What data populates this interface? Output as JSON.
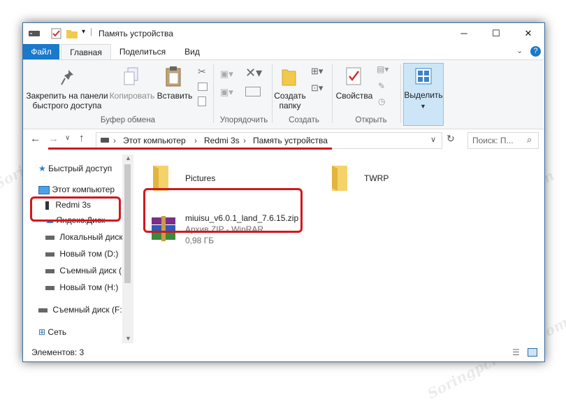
{
  "window": {
    "title": "Память устройства",
    "controls": {
      "minimize": "─",
      "maximize": "☐",
      "close": "✕"
    }
  },
  "ribbon": {
    "tabs": [
      {
        "label": "Файл"
      },
      {
        "label": "Главная"
      },
      {
        "label": "Поделиться"
      },
      {
        "label": "Вид"
      }
    ],
    "pin_label_1": "Закрепить на панели",
    "pin_label_2": "быстрого доступа",
    "copy_label": "Копировать",
    "paste_label": "Вставить",
    "new_folder_1": "Создать",
    "new_folder_2": "папку",
    "properties_label": "Свойства",
    "select_label": "Выделить",
    "groups": {
      "clipboard": "Буфер обмена",
      "organize": "Упорядочить",
      "create": "Создать",
      "open": "Открыть"
    }
  },
  "address": {
    "crumbs": [
      "Этот компьютер",
      "Redmi 3s",
      "Память устройства"
    ],
    "search_placeholder": "Поиск: П...",
    "separator": "›"
  },
  "nav": {
    "items": [
      {
        "label": "Быстрый доступ",
        "icon": "star-icon"
      },
      {
        "label": "Этот компьютер",
        "icon": "computer-icon"
      },
      {
        "label": "Redmi 3s",
        "icon": "phone-icon"
      },
      {
        "label": "Яндекс.Диск",
        "icon": "cloud-icon"
      },
      {
        "label": "Локальный диск",
        "icon": "drive-icon"
      },
      {
        "label": "Новый том (D:)",
        "icon": "drive-icon"
      },
      {
        "label": "Съемный диск (",
        "icon": "drive-icon"
      },
      {
        "label": "Новый том (H:)",
        "icon": "drive-icon"
      },
      {
        "label": "Съемный диск (F:",
        "icon": "drive-icon"
      },
      {
        "label": "Сеть",
        "icon": "network-icon"
      }
    ]
  },
  "files": [
    {
      "name": "Pictures",
      "type": "folder"
    },
    {
      "name": "TWRP",
      "type": "folder"
    },
    {
      "name": "miuisu_v6.0.1_land_7.6.15.zip",
      "kind": "Архив ZIP - WinRAR",
      "size": "0,98 ГБ",
      "type": "archive"
    }
  ],
  "status": {
    "count": "Элементов: 3"
  },
  "watermark": "Soringpcrepair.Com",
  "colors": {
    "accent": "#1979ca",
    "highlight": "#d0181f"
  }
}
